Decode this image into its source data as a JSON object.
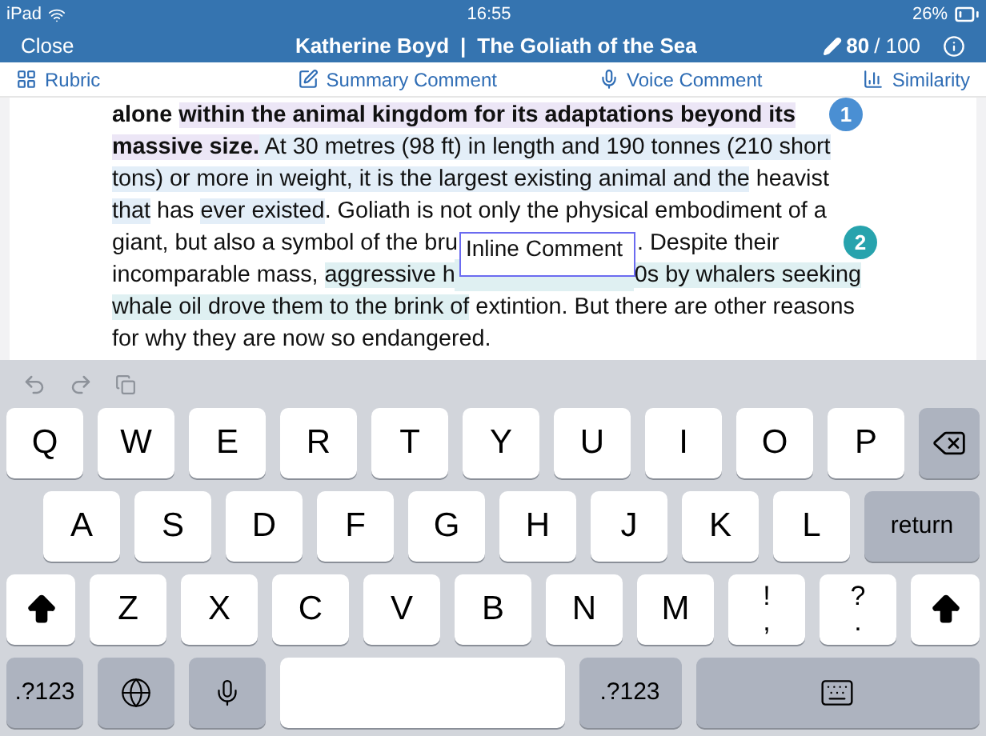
{
  "status_bar": {
    "device": "iPad",
    "time": "16:55",
    "battery": "26%"
  },
  "nav_bar": {
    "close": "Close",
    "student": "Katherine Boyd",
    "separator": "|",
    "title": "The Goliath of the Sea",
    "score": "80",
    "total": "/ 100"
  },
  "toolbar": [
    {
      "kind": "grid",
      "label": "Rubric"
    },
    {
      "kind": "edit",
      "label": "Summary Comment"
    },
    {
      "kind": "mic",
      "label": "Voice Comment"
    },
    {
      "kind": "chart",
      "label": "Similarity"
    }
  ],
  "document": {
    "lines": [
      {
        "segments": [
          {
            "text": "alone ",
            "bold": true
          },
          {
            "text": "within the animal kingdom for its adaptations beyond its",
            "bold": true,
            "color": "#ece6f6"
          }
        ],
        "marker": {
          "label": "1",
          "color": "#4a8fd3"
        }
      },
      {
        "segments": [
          {
            "text": "massive size.",
            "bold": true,
            "color": "#ece6f6"
          },
          {
            "text": " At 30 metres (98 ft) in length and 190 tonnes (210 short",
            "color": "#e3eef8"
          }
        ]
      },
      {
        "segments": [
          {
            "text": "tons) or more in weight, it is the largest existing animal and the",
            "color": "#e3eef8"
          },
          {
            "text": " heavist"
          }
        ]
      },
      {
        "segments": [
          {
            "text": "that",
            "color": "#e3eef8"
          },
          {
            "text": " has "
          },
          {
            "text": "ever existed",
            "color": "#e3eef8"
          },
          {
            "text": ". Goliath is not only the physical embodiment of a"
          }
        ]
      },
      {
        "segments": [
          {
            "text": "giant, but also a symbol of the bru"
          },
          {
            "kind": "gap"
          },
          {
            "text": ". Despite their"
          }
        ],
        "marker": {
          "label": "2",
          "color": "#27a3ad"
        }
      },
      {
        "segments": [
          {
            "text": "incomparable mass, "
          },
          {
            "text": "aggressive h",
            "color": "#dff0f2"
          },
          {
            "kind": "gap",
            "color": "#dff0f2"
          },
          {
            "text": "0s by whalers seeking",
            "color": "#dff0f2"
          }
        ]
      },
      {
        "segments": [
          {
            "text": "whale oil drove them to the brink of",
            "color": "#dff0f2"
          },
          {
            "text": " extintion. But there are other reasons"
          }
        ]
      },
      {
        "segments": [
          {
            "text": "for why they are now so endangered."
          }
        ]
      }
    ],
    "inline_comment": {
      "text": "Inline Comment"
    }
  },
  "keyboard": {
    "rows": [
      [
        {
          "kind": "letter",
          "label": "Q"
        },
        {
          "kind": "letter",
          "label": "W"
        },
        {
          "kind": "letter",
          "label": "E"
        },
        {
          "kind": "letter",
          "label": "R"
        },
        {
          "kind": "letter",
          "label": "T"
        },
        {
          "kind": "letter",
          "label": "Y"
        },
        {
          "kind": "letter",
          "label": "U"
        },
        {
          "kind": "letter",
          "label": "I"
        },
        {
          "kind": "letter",
          "label": "O"
        },
        {
          "kind": "letter",
          "label": "P"
        },
        {
          "kind": "delete"
        }
      ],
      [
        {
          "kind": "letter",
          "label": "A"
        },
        {
          "kind": "letter",
          "label": "S"
        },
        {
          "kind": "letter",
          "label": "D"
        },
        {
          "kind": "letter",
          "label": "F"
        },
        {
          "kind": "letter",
          "label": "G"
        },
        {
          "kind": "letter",
          "label": "H"
        },
        {
          "kind": "letter",
          "label": "J"
        },
        {
          "kind": "letter",
          "label": "K"
        },
        {
          "kind": "letter",
          "label": "L"
        },
        {
          "kind": "return",
          "label": "return"
        }
      ],
      [
        {
          "kind": "shift"
        },
        {
          "kind": "letter",
          "label": "Z"
        },
        {
          "kind": "letter",
          "label": "X"
        },
        {
          "kind": "letter",
          "label": "C"
        },
        {
          "kind": "letter",
          "label": "V"
        },
        {
          "kind": "letter",
          "label": "B"
        },
        {
          "kind": "letter",
          "label": "N"
        },
        {
          "kind": "letter",
          "label": "M"
        },
        {
          "kind": "dual",
          "label": "!",
          "sub": ","
        },
        {
          "kind": "dual",
          "label": "?",
          "sub": "."
        },
        {
          "kind": "shift"
        }
      ],
      [
        {
          "kind": "numbers",
          "label": ".?123"
        },
        {
          "kind": "globe"
        },
        {
          "kind": "mic"
        },
        {
          "kind": "space"
        },
        {
          "kind": "numbers",
          "label": ".?123"
        },
        {
          "kind": "hide"
        }
      ]
    ]
  }
}
